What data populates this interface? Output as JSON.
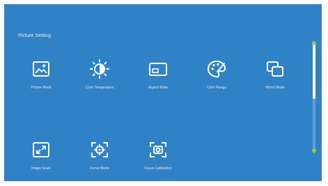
{
  "section": {
    "title": "Picture Setting"
  },
  "items": [
    {
      "label": "Picture Mode",
      "icon": "picture-mode-icon"
    },
    {
      "label": "Color Temperature",
      "icon": "color-temperature-icon"
    },
    {
      "label": "Aspect Ratio",
      "icon": "aspect-ratio-icon"
    },
    {
      "label": "Color Range",
      "icon": "color-range-icon"
    },
    {
      "label": "Mirror Mode",
      "icon": "mirror-mode-icon"
    },
    {
      "label": "Image Scale",
      "icon": "image-scale-icon"
    },
    {
      "label": "Focus Mode",
      "icon": "focus-mode-icon"
    },
    {
      "label": "Focus Calibration",
      "icon": "focus-calibration-icon"
    }
  ],
  "colors": {
    "background": "#2f82c6",
    "accent": "#8bd23a",
    "foreground": "#ffffff"
  }
}
